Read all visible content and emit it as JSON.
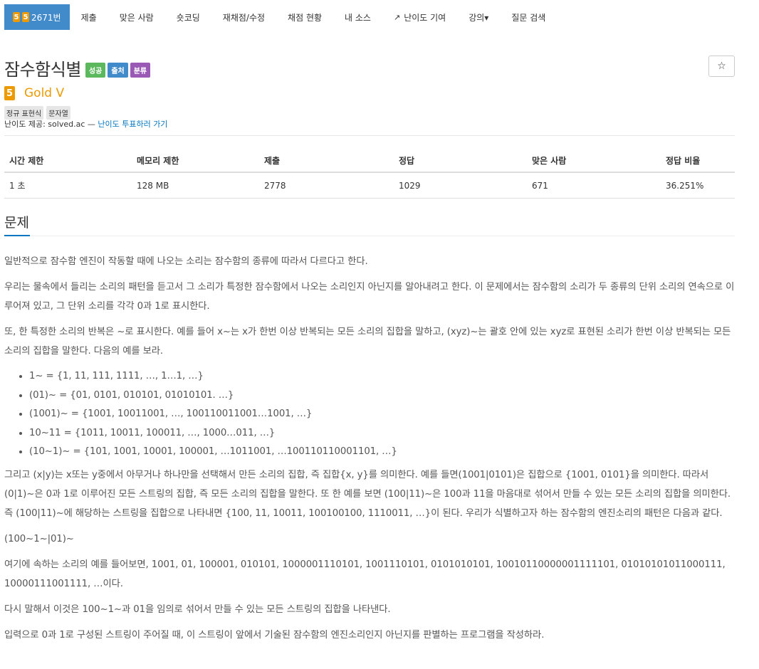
{
  "nav": {
    "active": {
      "badge": "5",
      "badge2": "5",
      "label": "2671번"
    },
    "items": [
      {
        "label": "제출"
      },
      {
        "label": "맞은 사람"
      },
      {
        "label": "숏코딩"
      },
      {
        "label": "재채점/수정"
      },
      {
        "label": "채점 현황"
      },
      {
        "label": "내 소스"
      },
      {
        "label": "난이도 기여"
      },
      {
        "label": "강의▾"
      },
      {
        "label": "질문 검색"
      }
    ]
  },
  "problem": {
    "title": "잠수함식별",
    "labels": [
      {
        "text": "성공",
        "color": "#5cb85c"
      },
      {
        "text": "출처",
        "color": "#428bca"
      },
      {
        "text": "분류",
        "color": "#9b59b6"
      }
    ],
    "star": "☆",
    "tier_icon": "5",
    "tier_name": "Gold V",
    "tier_color": "#ec9a00",
    "tags": [
      "정규 표현식",
      "문자열"
    ],
    "credit_prefix": "난이도 제공: solved.ac — ",
    "credit_link": "난이도 투표하러 가기"
  },
  "stats": {
    "headers": [
      "시간 제한",
      "메모리 제한",
      "제출",
      "정답",
      "맞은 사람",
      "정답 비율"
    ],
    "row": [
      "1 초",
      "128 MB",
      "2778",
      "1029",
      "671",
      "36.251%"
    ]
  },
  "section": {
    "title": "문제"
  },
  "content": {
    "p1": "일반적으로 잠수함 엔진이 작동할 때에 나오는 소리는 잠수함의 종류에 따라서 다르다고 한다.",
    "p2": "우리는 물속에서 들리는 소리의 패턴을 듣고서 그 소리가 특정한 잠수함에서 나오는 소리인지 아닌지를 알아내려고 한다. 이 문제에서는 잠수함의 소리가 두 종류의 단위 소리의 연속으로 이루어져 있고, 그 단위 소리를 각각 0과 1로 표시한다.",
    "p3": "또, 한 특정한 소리의 반복은 ~로 표시한다. 예를 들어 x~는 x가 한번 이상 반복되는 모든 소리의 집합을 말하고, (xyz)~는 괄호 안에 있는 xyz로 표현된 소리가 한번 이상 반복되는 모든 소리의 집합을 말한다. 다음의 예를 보라.",
    "list": [
      "1~ = {1, 11, 111, 1111, …, 1…1, …}",
      "(01)~ = {01, 0101, 010101, 01010101. …}",
      "(1001)~ = {1001, 10011001, …, 100110011001…1001, …}",
      "10~11 = {1011, 10011, 100011, …, 1000…011, …}",
      "(10~1)~ = {101, 1001, 10001, 100001, …1011001, …100110110001101, …}"
    ],
    "p4": "그리고 (x|y)는 x또는 y중에서 아무거나 하나만을 선택해서 만든 소리의 집합, 즉 집합{x, y}를 의미한다. 예를 들면(1001|0101)은 집합으로 {1001, 0101}을 의미한다. 따라서 (0|1)~은 0과 1로 이루어진 모든 스트링의 집합, 즉 모든 소리의 집합을 말한다. 또 한 예를 보면 (100|11)~은 100과 11을 마음대로 섞어서 만들 수 있는 모든 소리의 집합을 의미한다. 즉 (100|11)~에 해당하는 스트링을 집합으로 나타내면 {100, 11, 10011, 100100100, 1110011, …}이 된다. 우리가 식별하고자 하는 잠수함의 엔진소리의 패턴은 다음과 같다.",
    "p5": "(100~1~|01)~",
    "p6": "여기에 속하는 소리의 예를 들어보면, 1001, 01, 100001, 010101, 1000001110101, 1001110101, 0101010101, 10010110000001111101, 01010101011000111, 10000111001111, …이다.",
    "p7": "다시 말해서 이것은 100~1~과 01을 임의로 섞어서 만들 수 있는 모든 스트링의 집합을 나타낸다.",
    "p8": "입력으로 0과 1로 구성된 스트링이 주어질 때, 이 스트링이 앞에서 기술된 잠수함의 엔진소리인지 아닌지를 판별하는 프로그램을 작성하라."
  }
}
